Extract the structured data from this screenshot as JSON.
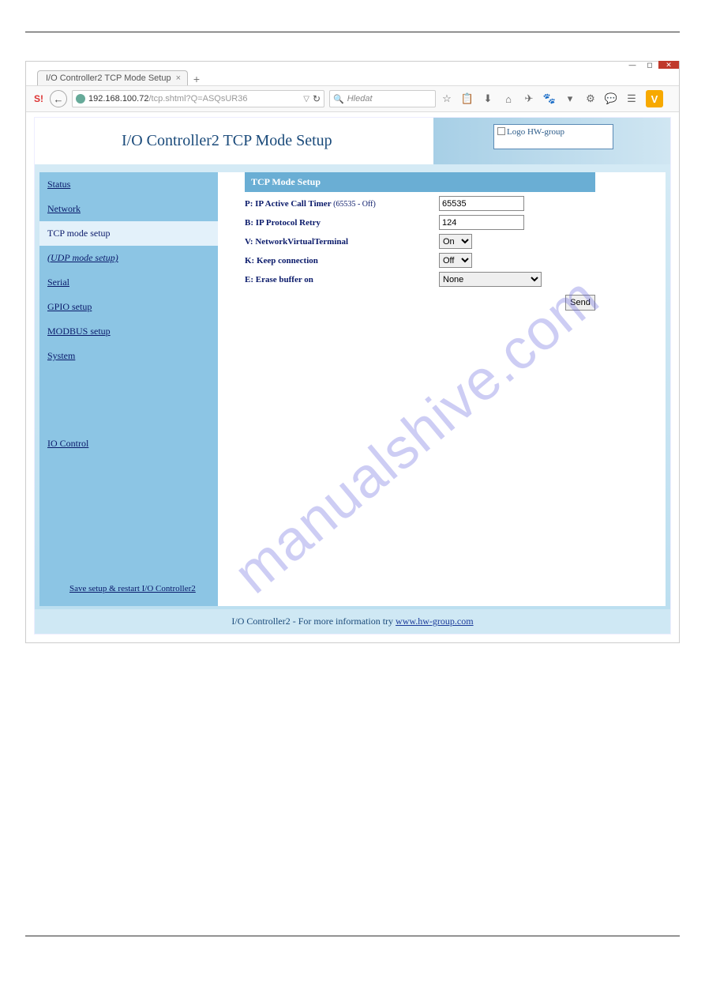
{
  "browser": {
    "tab_title": "I/O Controller2 TCP Mode Setup",
    "url_host": "192.168.100.72",
    "url_path": "/tcp.shtml?Q=ASQsUR36",
    "search_placeholder": "Hledat"
  },
  "page": {
    "title": "I/O Controller2 TCP Mode Setup",
    "logo_text": "Logo HW-group"
  },
  "sidebar": {
    "items": [
      {
        "label": "Status"
      },
      {
        "label": "Network"
      },
      {
        "label": "TCP mode setup"
      },
      {
        "label": "(UDP mode setup)"
      },
      {
        "label": "Serial"
      },
      {
        "label": "GPIO setup"
      },
      {
        "label": "MODBUS setup"
      },
      {
        "label": "System"
      }
    ],
    "io_control": "IO Control",
    "save_restart": "Save setup & restart I/O Controller2"
  },
  "panel": {
    "header": "TCP Mode Setup",
    "rows": {
      "p_label": "P: IP Active Call Timer",
      "p_hint": "(65535 - Off)",
      "p_value": "65535",
      "b_label": "B: IP Protocol Retry",
      "b_value": "124",
      "v_label": "V: NetworkVirtualTerminal",
      "v_value": "On",
      "k_label": "K: Keep connection",
      "k_value": "Off",
      "e_label": "E: Erase buffer on",
      "e_value": "None"
    },
    "send_label": "Send"
  },
  "footer": {
    "prefix": "I/O Controller2 - For more information try ",
    "link_text": "www.hw-group.com"
  },
  "watermark": "manualshive.com"
}
